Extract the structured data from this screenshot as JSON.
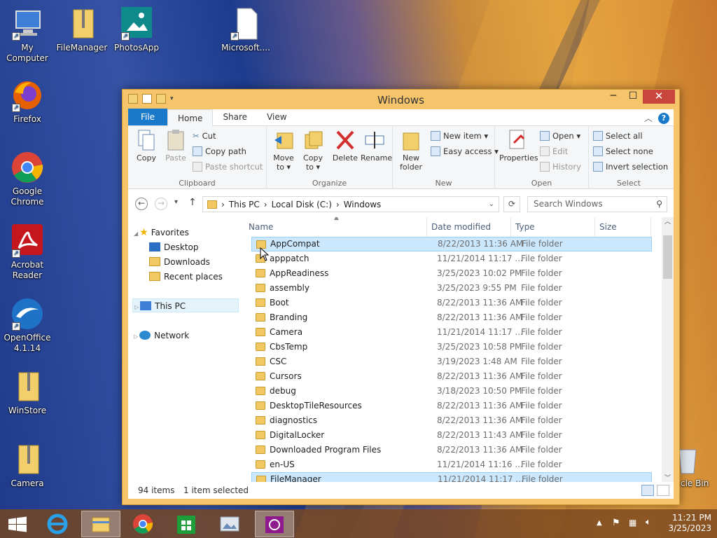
{
  "desktop": {
    "icons": [
      {
        "label": "My Computer",
        "icon": "computer-icon"
      },
      {
        "label": "FileManager",
        "icon": "zip-folder-icon"
      },
      {
        "label": "PhotosApp",
        "icon": "photos-icon"
      },
      {
        "label": "Microsoft....",
        "icon": "document-icon"
      },
      {
        "label": "Firefox",
        "icon": "firefox-icon"
      },
      {
        "label": "Google Chrome",
        "icon": "chrome-icon"
      },
      {
        "label": "Acrobat Reader",
        "icon": "acrobat-icon"
      },
      {
        "label": "OpenOffice 4.1.14",
        "icon": "openoffice-icon"
      },
      {
        "label": "WinStore",
        "icon": "zip-folder-icon"
      },
      {
        "label": "Camera",
        "icon": "zip-folder-icon"
      },
      {
        "label": "cle Bin",
        "icon": "recycle-bin-icon"
      }
    ]
  },
  "window": {
    "title": "Windows",
    "tabs": {
      "file": "File",
      "home": "Home",
      "share": "Share",
      "view": "View"
    },
    "ribbon": {
      "clipboard": {
        "copy": "Copy",
        "paste": "Paste",
        "cut": "Cut",
        "copy_path": "Copy path",
        "paste_shortcut": "Paste shortcut",
        "label": "Clipboard"
      },
      "organize": {
        "move_to": "Move to ▾",
        "copy_to": "Copy to ▾",
        "delete": "Delete",
        "rename": "Rename",
        "label": "Organize"
      },
      "new": {
        "new_folder": "New folder",
        "new_item": "New item ▾",
        "easy_access": "Easy access ▾",
        "label": "New"
      },
      "open": {
        "properties": "Properties",
        "open": "Open ▾",
        "edit": "Edit",
        "history": "History",
        "label": "Open"
      },
      "select": {
        "select_all": "Select all",
        "select_none": "Select none",
        "invert": "Invert selection",
        "label": "Select"
      }
    },
    "address": {
      "this_pc": "This PC",
      "drive": "Local Disk (C:)",
      "folder": "Windows"
    },
    "search_placeholder": "Search Windows",
    "nav": {
      "favorites": "Favorites",
      "desktop": "Desktop",
      "downloads": "Downloads",
      "recent": "Recent places",
      "this_pc": "This PC",
      "network": "Network"
    },
    "columns": {
      "name": "Name",
      "date": "Date modified",
      "type": "Type",
      "size": "Size"
    },
    "files": [
      {
        "name": "AppCompat",
        "date": "8/22/2013 11:36 AM",
        "type": "File folder",
        "selected": true
      },
      {
        "name": "apppatch",
        "date": "11/21/2014 11:17 ...",
        "type": "File folder"
      },
      {
        "name": "AppReadiness",
        "date": "3/25/2023 10:02 PM",
        "type": "File folder"
      },
      {
        "name": "assembly",
        "date": "3/25/2023 9:55 PM",
        "type": "File folder"
      },
      {
        "name": "Boot",
        "date": "8/22/2013 11:36 AM",
        "type": "File folder"
      },
      {
        "name": "Branding",
        "date": "8/22/2013 11:36 AM",
        "type": "File folder"
      },
      {
        "name": "Camera",
        "date": "11/21/2014 11:17 ...",
        "type": "File folder"
      },
      {
        "name": "CbsTemp",
        "date": "3/25/2023 10:58 PM",
        "type": "File folder"
      },
      {
        "name": "CSC",
        "date": "3/19/2023 1:48 AM",
        "type": "File folder"
      },
      {
        "name": "Cursors",
        "date": "8/22/2013 11:36 AM",
        "type": "File folder"
      },
      {
        "name": "debug",
        "date": "3/18/2023 10:50 PM",
        "type": "File folder"
      },
      {
        "name": "DesktopTileResources",
        "date": "8/22/2013 11:36 AM",
        "type": "File folder"
      },
      {
        "name": "diagnostics",
        "date": "8/22/2013 11:36 AM",
        "type": "File folder"
      },
      {
        "name": "DigitalLocker",
        "date": "8/22/2013 11:43 AM",
        "type": "File folder"
      },
      {
        "name": "Downloaded Program Files",
        "date": "8/22/2013 11:36 AM",
        "type": "File folder"
      },
      {
        "name": "en-US",
        "date": "11/21/2014 11:16 ...",
        "type": "File folder"
      },
      {
        "name": "FileManager",
        "date": "11/21/2014 11:17 ...",
        "type": "File folder",
        "selected": true
      }
    ],
    "status": {
      "count": "94 items",
      "selected": "1 item selected"
    }
  },
  "taskbar": {
    "time": "11:21 PM",
    "date": "3/25/2023"
  }
}
